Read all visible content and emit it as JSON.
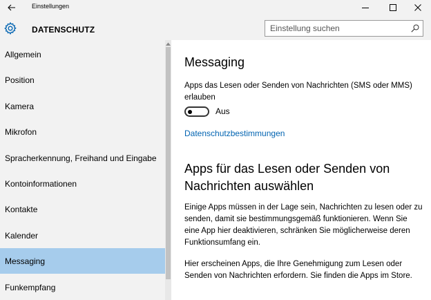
{
  "window": {
    "title": "Einstellungen",
    "back_icon": "back-arrow-icon",
    "controls": [
      "minimize-icon",
      "maximize-icon",
      "close-icon"
    ]
  },
  "header": {
    "icon": "gear-icon",
    "title": "DATENSCHUTZ",
    "search_placeholder": "Einstellung suchen"
  },
  "sidebar": {
    "items": [
      {
        "label": "Allgemein"
      },
      {
        "label": "Position"
      },
      {
        "label": "Kamera"
      },
      {
        "label": "Mikrofon"
      },
      {
        "label": "Spracherkennung, Freihand und Eingabe"
      },
      {
        "label": "Kontoinformationen"
      },
      {
        "label": "Kontakte"
      },
      {
        "label": "Kalender"
      },
      {
        "label": "Messaging",
        "selected": true
      },
      {
        "label": "Funkempfang"
      }
    ]
  },
  "content": {
    "title": "Messaging",
    "toggle_description": "Apps das Lesen oder Senden von Nachrichten (SMS oder MMS) erlauben",
    "toggle_state": "Aus",
    "privacy_link": "Datenschutzbestimmungen",
    "section_title": "Apps für das Lesen oder Senden von Nachrichten auswählen",
    "paragraph1": "Einige Apps müssen in der Lage sein, Nachrichten zu lesen oder zu senden, damit sie bestimmungsgemäß funktionieren. Wenn Sie eine App hier deaktivieren, schränken Sie möglicherweise deren Funktionsumfang ein.",
    "paragraph2": "Hier erscheinen Apps, die Ihre Genehmigung zum Lesen oder Senden von Nachrichten erfordern. Sie finden die Apps im Store."
  },
  "colors": {
    "chrome_bg": "#f2f2f2",
    "selected_bg": "#a6ccec",
    "link": "#0063b1",
    "accent_icon": "#0063b1"
  }
}
